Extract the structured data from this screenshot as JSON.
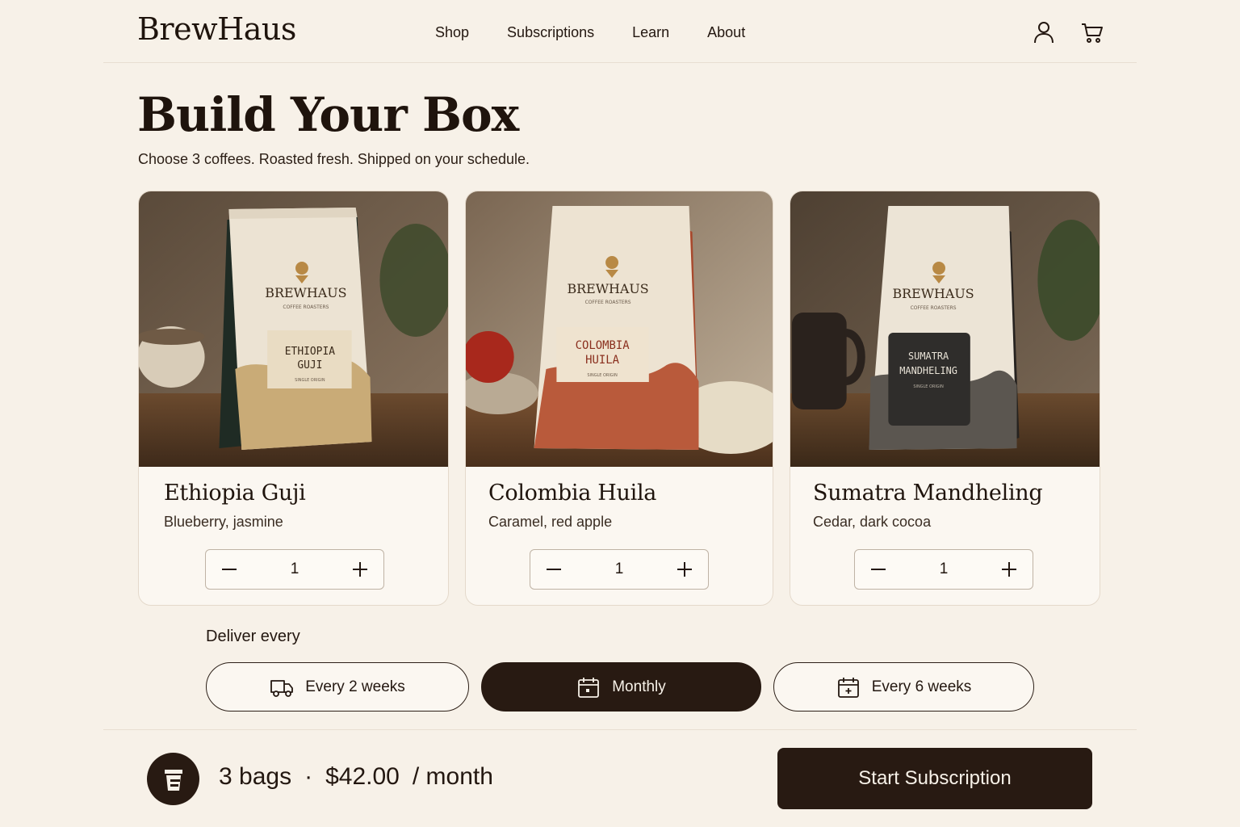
{
  "brand": {
    "name": "BrewHaus"
  },
  "nav": {
    "items": [
      {
        "label": "Shop"
      },
      {
        "label": "Subscriptions"
      },
      {
        "label": "Learn"
      },
      {
        "label": "About"
      }
    ]
  },
  "header_icons": [
    "account-icon",
    "cart-icon"
  ],
  "hero": {
    "title": "Build Your Box",
    "subtitle": "Choose 3 coffees. Roasted fresh. Shipped on your schedule."
  },
  "products": [
    {
      "name": "Ethiopia Guji",
      "notes": "Blueberry, jasmine",
      "quantity": "1",
      "bag": {
        "brand": "BREWHAUS",
        "tagline": "COFFEE ROASTERS",
        "label_line1": "ETHIOPIA",
        "label_line2": "GUJI",
        "label_sub": "SINGLE ORIGIN",
        "accent": "#1f2b24",
        "label_color": "#e9dcc3",
        "text_color": "#3a2a1a"
      }
    },
    {
      "name": "Colombia Huila",
      "notes": "Caramel, red apple",
      "quantity": "1",
      "bag": {
        "brand": "BREWHAUS",
        "tagline": "COFFEE ROASTERS",
        "label_line1": "COLOMBIA",
        "label_line2": "HUILA",
        "label_sub": "SINGLE ORIGIN",
        "accent": "#a8482c",
        "label_color": "#efe3cf",
        "text_color": "#8a2f1e"
      }
    },
    {
      "name": "Sumatra Mandheling",
      "notes": "Cedar, dark cocoa",
      "quantity": "1",
      "bag": {
        "brand": "BREWHAUS",
        "tagline": "COFFEE ROASTERS",
        "label_line1": "SUMATRA",
        "label_line2": "MANDHELING",
        "label_sub": "SINGLE ORIGIN",
        "accent": "#26221f",
        "label_color": "#2f2d2b",
        "text_color": "#e8e2d6"
      }
    }
  ],
  "delivery": {
    "label": "Deliver every",
    "options": [
      {
        "label": "Every 2 weeks",
        "icon": "truck-icon",
        "selected": false
      },
      {
        "label": "Monthly",
        "icon": "calendar-icon",
        "selected": true
      },
      {
        "label": "Every 6 weeks",
        "icon": "calendar-add-icon",
        "selected": false
      }
    ]
  },
  "summary": {
    "icon": "coffee-cup-icon",
    "bags": "3 bags",
    "separator": "·",
    "price": "$42.00",
    "period": "/ month",
    "cta": "Start Subscription"
  },
  "colors": {
    "background": "#f7f1e8",
    "primary_dark": "#281a12",
    "card": "#fbf7f1",
    "border": "#e4d9cb"
  }
}
